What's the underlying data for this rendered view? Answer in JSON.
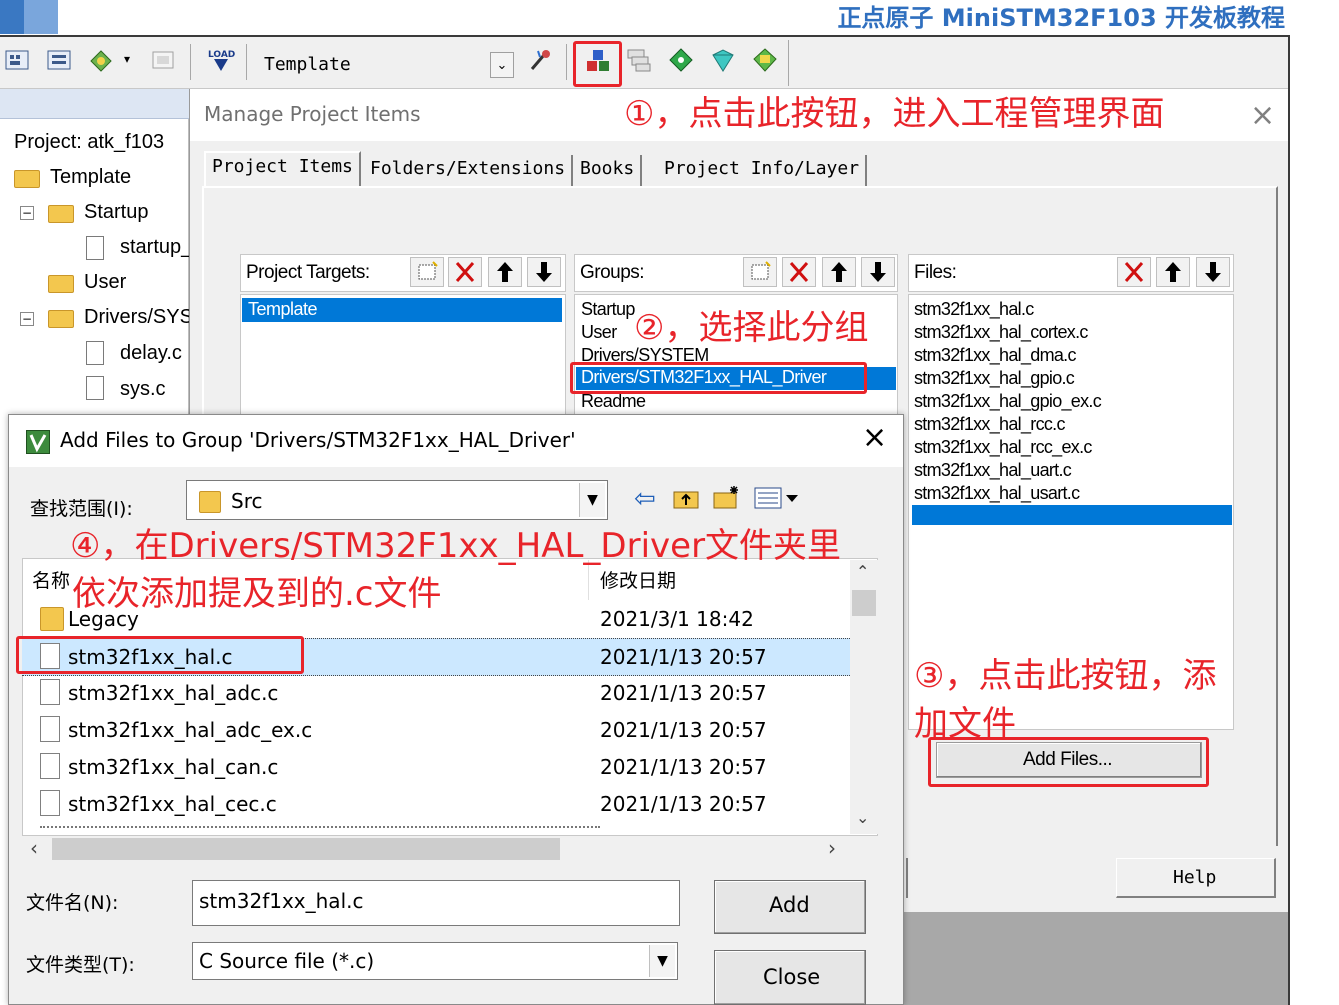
{
  "header": {
    "brand_title": "正点原子 MiniSTM32F103 开发板教程"
  },
  "toolbar": {
    "target_name": "Template",
    "load_label": "LOAD"
  },
  "project_tree": {
    "title": "Project: atk_f103",
    "items": [
      "Template",
      "Startup",
      "startup_",
      "User",
      "Drivers/SYS",
      "delay.c",
      "sys.c"
    ]
  },
  "manage_dialog": {
    "title": "Manage Project Items",
    "tabs": [
      "Project Items",
      "Folders/Extensions",
      "Books",
      "Project Info/Layer"
    ],
    "targets_label": "Project Targets:",
    "targets": [
      "Template"
    ],
    "groups_label": "Groups:",
    "groups": [
      "Startup",
      "User",
      "Drivers/SYSTEM",
      "Drivers/STM32F1xx_HAL_Driver",
      "Readme"
    ],
    "files_label": "Files:",
    "files": [
      "stm32f1xx_hal.c",
      "stm32f1xx_hal_cortex.c",
      "stm32f1xx_hal_dma.c",
      "stm32f1xx_hal_gpio.c",
      "stm32f1xx_hal_gpio_ex.c",
      "stm32f1xx_hal_rcc.c",
      "stm32f1xx_hal_rcc_ex.c",
      "stm32f1xx_hal_uart.c",
      "stm32f1xx_hal_usart.c"
    ],
    "add_files_button": "Add Files...",
    "help_button": "Help"
  },
  "add_dialog": {
    "title": "Add Files to Group 'Drivers/STM32F1xx_HAL_Driver'",
    "look_in_label": "查找范围(I):",
    "look_in_value": "Src",
    "col_name": "名称",
    "col_date": "修改日期",
    "rows": [
      {
        "name": "Legacy",
        "date": "2021/3/1 18:42",
        "type": "folder"
      },
      {
        "name": "stm32f1xx_hal.c",
        "date": "2021/1/13 20:57",
        "type": "file"
      },
      {
        "name": "stm32f1xx_hal_adc.c",
        "date": "2021/1/13 20:57",
        "type": "file"
      },
      {
        "name": "stm32f1xx_hal_adc_ex.c",
        "date": "2021/1/13 20:57",
        "type": "file"
      },
      {
        "name": "stm32f1xx_hal_can.c",
        "date": "2021/1/13 20:57",
        "type": "file"
      },
      {
        "name": "stm32f1xx_hal_cec.c",
        "date": "2021/1/13 20:57",
        "type": "file"
      }
    ],
    "filename_label": "文件名(N):",
    "filename_value": "stm32f1xx_hal.c",
    "filetype_label": "文件类型(T):",
    "filetype_value": "C Source file (*.c)",
    "add_button": "Add",
    "close_button": "Close"
  },
  "annotations": {
    "step1": "①，点击此按钮，进入工程管理界面",
    "step2": "②，选择此分组",
    "step3_line1": "③，点击此按钮，添",
    "step3_line2": "加文件",
    "step4_line1": "④，在Drivers/STM32F1xx_HAL_Driver文件夹里",
    "step4_line2": "依次添加提及到的.c文件"
  },
  "colors": {
    "annotation_red": "#e8242a",
    "selection_blue": "#0078d7",
    "header_blue": "#2f6fbf"
  }
}
